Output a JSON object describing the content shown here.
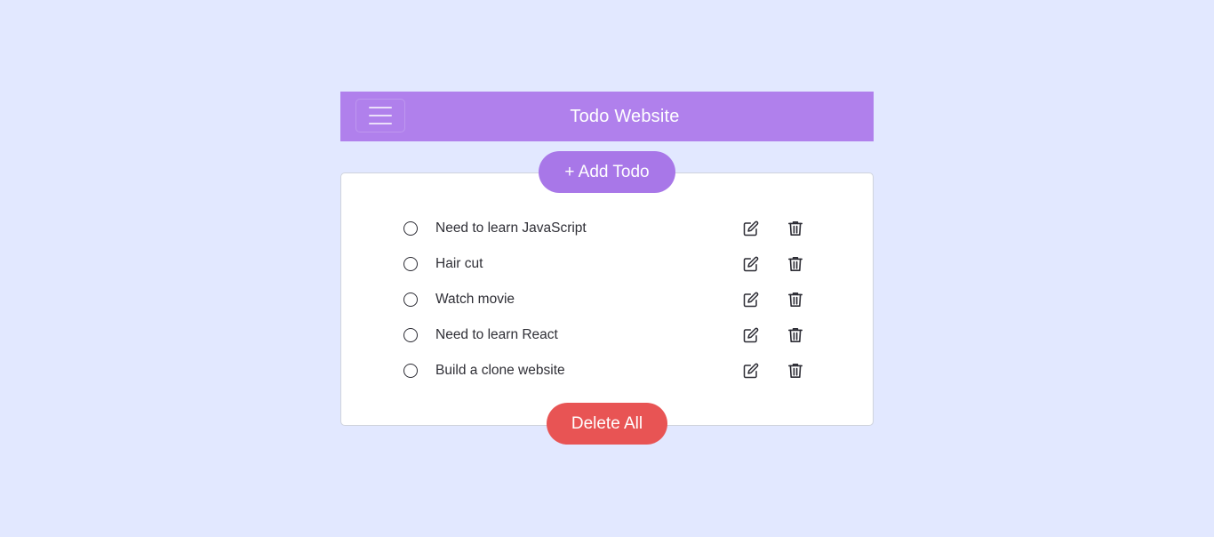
{
  "header": {
    "title": "Todo Website",
    "menu_icon": "hamburger-icon",
    "background_color": "#b080ec"
  },
  "actions": {
    "add_label": "+ Add Todo",
    "add_color": "#a877e8",
    "delete_all_label": "Delete All",
    "delete_all_color": "#e85454"
  },
  "todos": [
    {
      "text": "Need to learn JavaScript",
      "done": false
    },
    {
      "text": "Hair cut",
      "done": false
    },
    {
      "text": "Watch movie",
      "done": false
    },
    {
      "text": "Need to learn React",
      "done": false
    },
    {
      "text": "Build a clone website",
      "done": false
    }
  ],
  "item_icons": {
    "check": "circle-icon",
    "edit": "edit-icon",
    "delete": "trash-icon"
  },
  "page": {
    "background_color": "#e2e8ff"
  }
}
